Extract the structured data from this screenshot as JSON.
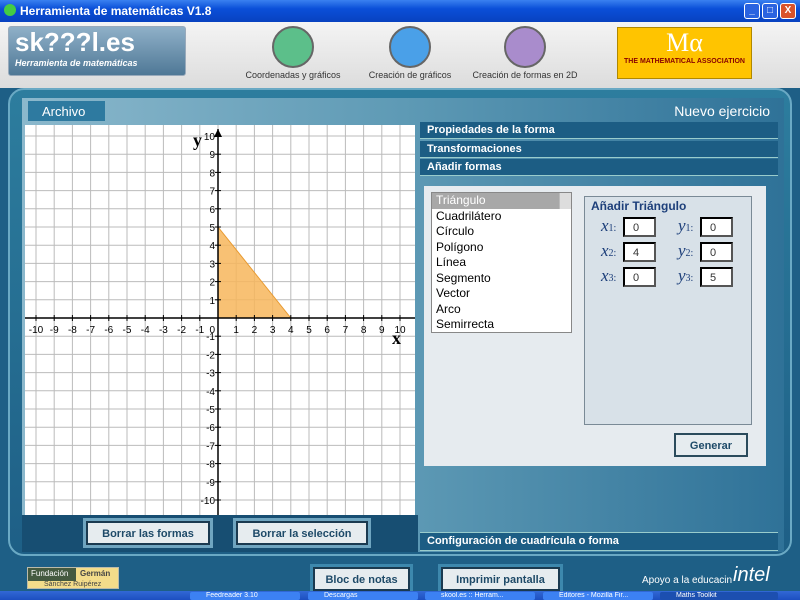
{
  "window": {
    "title": "Herramienta de matemáticas V1.8",
    "controls": [
      "_",
      "□",
      "X"
    ]
  },
  "toolbar": {
    "logo_text": "sk???l.es",
    "logo_subtitle": "Herramienta de matemáticas",
    "tools": [
      {
        "label": "Coordenadas y gráficos",
        "icon": "graph-icon",
        "color": "#5cbf8a"
      },
      {
        "label": "Creación de gráficos",
        "icon": "bar-chart-icon",
        "color": "#4aa0e8"
      },
      {
        "label": "Creación de formas en 2D",
        "icon": "shapes-icon",
        "color": "#a98ccc"
      }
    ],
    "partner_logo": {
      "symbol": "Mα",
      "text": "THE MATHEMATICAL ASSOCIATION"
    }
  },
  "menu": {
    "archivo": "Archivo",
    "nuevo": "Nuevo ejercicio"
  },
  "graph": {
    "x_label": "x",
    "y_label": "y",
    "range": [
      -10,
      10
    ],
    "shape": {
      "type": "Triángulo",
      "vertices": [
        [
          0,
          0
        ],
        [
          4,
          0
        ],
        [
          0,
          5
        ]
      ],
      "fill": "#f7b65c"
    }
  },
  "graph_buttons": {
    "clear_shapes": "Borrar las formas",
    "clear_selection": "Borrar la selección"
  },
  "panel": {
    "sections": [
      "Propiedades de la forma",
      "Transformaciones",
      "Añadir formas"
    ],
    "footer": "Configuración de cuadrícula o forma",
    "shapes": [
      "Triángulo",
      "Cuadrilátero",
      "Círculo",
      "Polígono",
      "Línea",
      "Segmento",
      "Vector",
      "Arco",
      "Semirrecta"
    ],
    "selected": "Triángulo",
    "add_title": "Añadir Triángulo",
    "fields": {
      "x1": "0",
      "y1": "0",
      "x2": "4",
      "y2": "0",
      "x3": "0",
      "y3": "5"
    },
    "generate": "Generar"
  },
  "footer": {
    "fundacion": "Fundación",
    "german": "Germán",
    "sanchez": "Sánchez Ruipérez",
    "notepad": "Bloc de notas",
    "print": "Imprimir pantalla",
    "support": "Apoyo a la educacin",
    "intel": "intel"
  },
  "taskbar": [
    "Feedreader 3.10",
    "Descargas",
    "skool.es :: Herram...",
    "Editores - Mozilla Fir...",
    "Maths Toolkit"
  ]
}
